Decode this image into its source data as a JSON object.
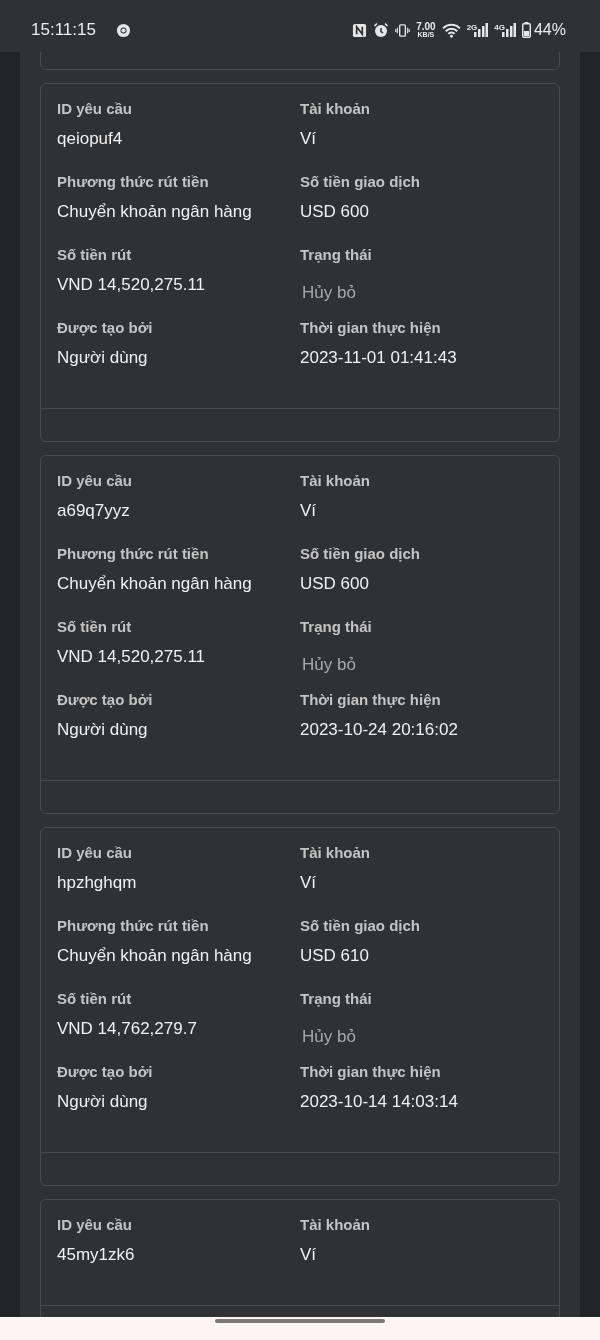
{
  "status_bar": {
    "time": "15:11:15",
    "net_speed": "7.00",
    "net_unit": "KB/S",
    "sim1": "2G",
    "sim2": "4G",
    "battery": "44%"
  },
  "cards": [
    {
      "fields": [
        {
          "label": "ID yêu cầu",
          "value": "qeiopuf4",
          "kind": "text"
        },
        {
          "label": "Tài khoản",
          "value": "Ví",
          "kind": "text"
        },
        {
          "label": "Phương thức rút tiền",
          "value": "Chuyển khoản ngân hàng",
          "kind": "text"
        },
        {
          "label": "Số tiền giao dịch",
          "value": "USD 600",
          "kind": "text"
        },
        {
          "label": "Số tiền rút",
          "value": "VND 14,520,275.11",
          "kind": "text"
        },
        {
          "label": "Trạng thái",
          "value": "Hủy bỏ",
          "kind": "status"
        },
        {
          "label": "Được tạo bởi",
          "value": "Người dùng",
          "kind": "text"
        },
        {
          "label": "Thời gian thực hiện",
          "value": "2023-11-01 01:41:43",
          "kind": "text"
        }
      ]
    },
    {
      "fields": [
        {
          "label": "ID yêu cầu",
          "value": "a69q7yyz",
          "kind": "text"
        },
        {
          "label": "Tài khoản",
          "value": "Ví",
          "kind": "text"
        },
        {
          "label": "Phương thức rút tiền",
          "value": "Chuyển khoản ngân hàng",
          "kind": "text"
        },
        {
          "label": "Số tiền giao dịch",
          "value": "USD 600",
          "kind": "text"
        },
        {
          "label": "Số tiền rút",
          "value": "VND 14,520,275.11",
          "kind": "text"
        },
        {
          "label": "Trạng thái",
          "value": "Hủy bỏ",
          "kind": "status"
        },
        {
          "label": "Được tạo bởi",
          "value": "Người dùng",
          "kind": "text"
        },
        {
          "label": "Thời gian thực hiện",
          "value": "2023-10-24 20:16:02",
          "kind": "text"
        }
      ]
    },
    {
      "fields": [
        {
          "label": "ID yêu cầu",
          "value": "hpzhghqm",
          "kind": "text"
        },
        {
          "label": "Tài khoản",
          "value": "Ví",
          "kind": "text"
        },
        {
          "label": "Phương thức rút tiền",
          "value": "Chuyển khoản ngân hàng",
          "kind": "text"
        },
        {
          "label": "Số tiền giao dịch",
          "value": "USD 610",
          "kind": "text"
        },
        {
          "label": "Số tiền rút",
          "value": "VND 14,762,279.7",
          "kind": "text"
        },
        {
          "label": "Trạng thái",
          "value": "Hủy bỏ",
          "kind": "status"
        },
        {
          "label": "Được tạo bởi",
          "value": "Người dùng",
          "kind": "text"
        },
        {
          "label": "Thời gian thực hiện",
          "value": "2023-10-14 14:03:14",
          "kind": "text"
        }
      ]
    },
    {
      "fields": [
        {
          "label": "ID yêu cầu",
          "value": "45my1zk6",
          "kind": "text"
        },
        {
          "label": "Tài khoản",
          "value": "Ví",
          "kind": "text"
        }
      ]
    }
  ]
}
